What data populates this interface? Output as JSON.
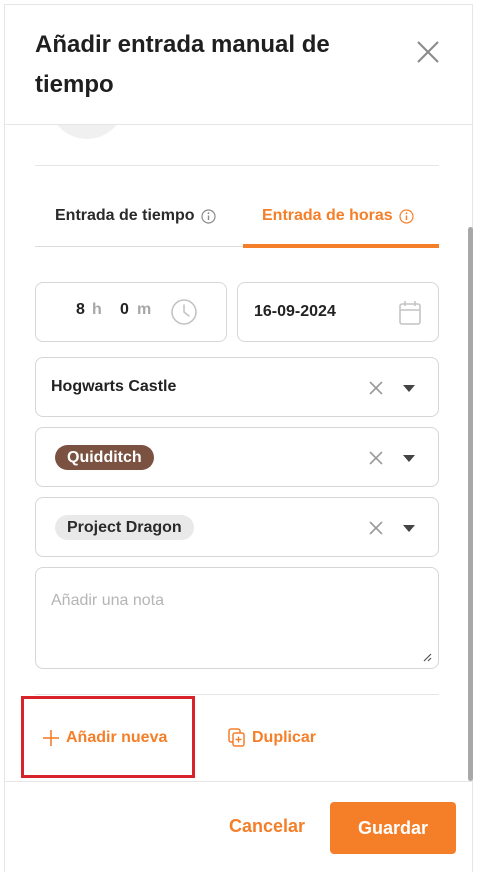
{
  "dialog": {
    "title": "Añadir entrada manual de tiempo",
    "close_icon": "close-icon"
  },
  "tabs": [
    {
      "label": "Entrada de tiempo",
      "active": false,
      "icon": "info-icon"
    },
    {
      "label": "Entrada de horas",
      "active": true,
      "icon": "info-icon"
    }
  ],
  "duration": {
    "hours": "8",
    "hours_unit": "h",
    "minutes": "0",
    "minutes_unit": "m",
    "icon": "clock-icon"
  },
  "date": {
    "value": "16-09-2024",
    "icon": "calendar-icon"
  },
  "selects": {
    "location": {
      "value": "Hogwarts Castle"
    },
    "activity": {
      "value": "Quidditch",
      "chip_color": "#7b5242"
    },
    "project": {
      "value": "Project Dragon",
      "chip_color": "#e9e9e9"
    }
  },
  "note": {
    "placeholder": "Añadir una nota",
    "value": ""
  },
  "actions": {
    "add_new_label": "Añadir nueva",
    "duplicate_label": "Duplicar"
  },
  "footer": {
    "cancel_label": "Cancelar",
    "save_label": "Guardar"
  },
  "colors": {
    "accent": "#f57f29",
    "highlight": "#d9232a",
    "border": "#d6d6d6"
  }
}
